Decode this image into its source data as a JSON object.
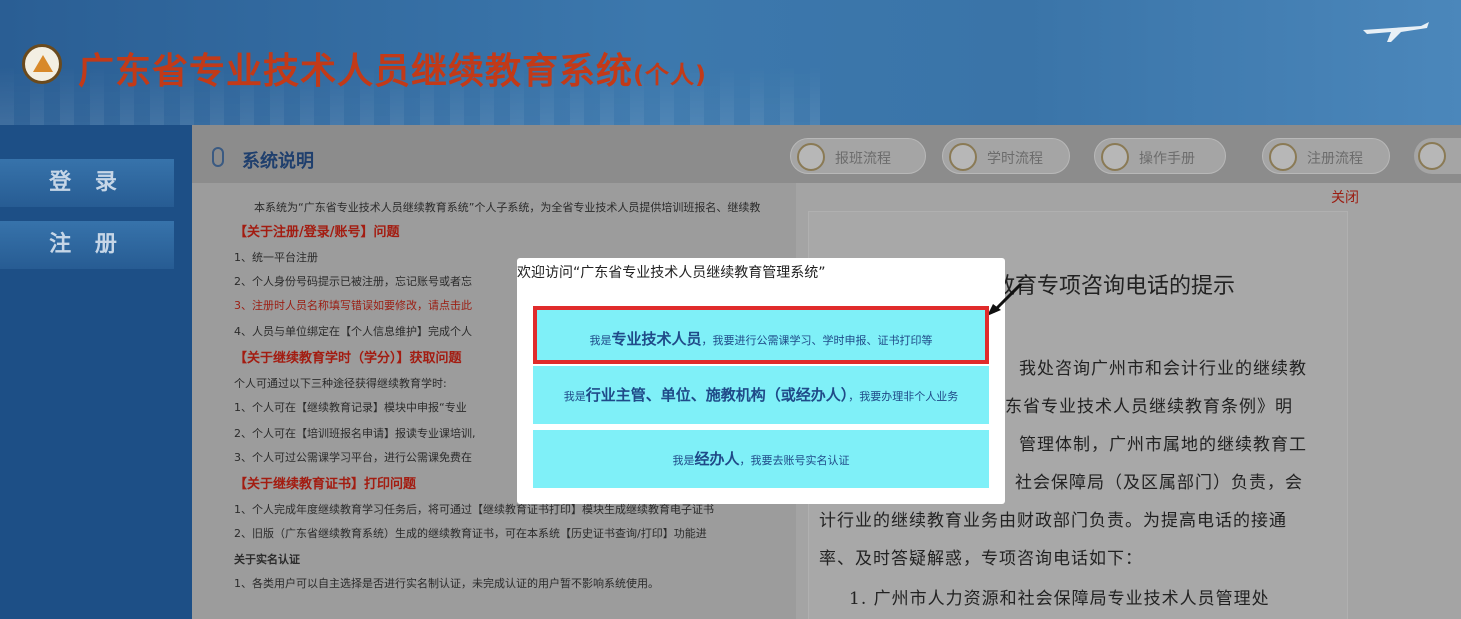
{
  "header": {
    "title": "广东省专业技术人员继续教育系统",
    "title_suffix": "(个人)"
  },
  "nav": {
    "login": "登 录",
    "register": "注 册"
  },
  "main": {
    "section_title": "系统说明",
    "tools": [
      "报班流程",
      "学时流程",
      "操作手册",
      "注册流程"
    ],
    "content": {
      "intro": "本系统为“广东省专业技术人员继续教育系统”个人子系统，为全省专业技术人员提供培训班报名、继续教",
      "sec1": "【关于注册/登录/账号】问题",
      "l1": "1、统一平台注册",
      "l2": "2、个人身份号码提示已被注册，忘记账号或者忘",
      "l3": "3、注册时人员名称填写错误如要修改，请点击此",
      "l4": "4、人员与单位绑定在【个人信息维护】完成个人",
      "sec2": "【关于继续教育学时（学分）】获取问题",
      "l5": "个人可通过以下三种途径获得继续教育学时:",
      "l6": "1、个人可在【继续教育记录】模块中申报“专业",
      "l7": "2、个人可在【培训班报名申请】报读专业课培训,",
      "l8": "3、个人可过公需课学习平台，进行公需课免费在",
      "sec3": "【关于继续教育证书】打印问题",
      "l9": "1、个人完成年度继续教育学习任务后，将可通过【继续教育证书打印】模块生成继续教育电子证书",
      "l10": "2、旧版（广东省继续教育系统）生成的继续教育证书，可在本系统【历史证书查询/打印】功能进",
      "sec4": "关于实名认证",
      "l11": "1、各类用户可以自主选择是否进行实名制认证，未完成认证的用户暂不影响系统使用。"
    }
  },
  "notice": {
    "close": "关闭",
    "title": "关于继续教育专项咨询电话的提示",
    "lines": [
      "我处咨询广州市和会计行业的继续教",
      "东省专业技术人员继续教育条例》明",
      "管理体制，广州市属地的继续教育工",
      "社会保障局（及区属部门）负责，会",
      "计行业的继续教育业务由财政部门负责。为提高电话的接通",
      "率、及时答疑解惑，专项咨询电话如下：",
      "1. 广州市人力资源和社会保障局专业技术人员管理处"
    ]
  },
  "modal": {
    "title": "欢迎访问“广东省专业技术人员继续教育管理系统”",
    "choices": [
      {
        "prefix": "我是",
        "role": "专业技术人员",
        "suffix": "，我要进行公需课学习、学时申报、证书打印等"
      },
      {
        "prefix": "我是",
        "role": "行业主管、单位、施教机构（或经办人）",
        "suffix": "，我要办理非个人业务"
      },
      {
        "prefix": "我是",
        "role": "经办人",
        "suffix": "，我要去账号实名认证"
      }
    ]
  },
  "colors": {
    "header_blue": "#3c78ad",
    "title_red": "#c23a18",
    "choice_cyan": "#7ff0f8",
    "highlight_red": "#e02b2b"
  }
}
